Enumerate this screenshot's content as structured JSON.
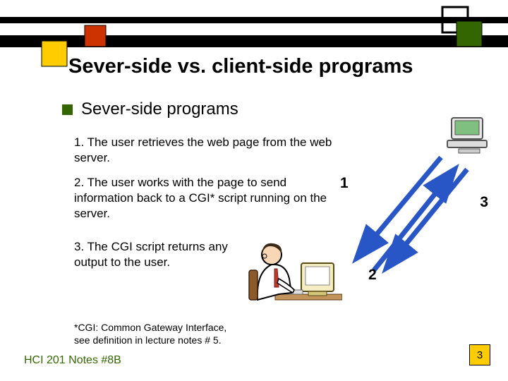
{
  "slide": {
    "title": "Sever-side vs. client-side programs",
    "subtitle": "Sever-side programs",
    "points": {
      "p1": "1. The user retrieves the web page from the web server.",
      "p2": "2. The user works with the page to send information back to a CGI* script running on the server.",
      "p3": "3. The CGI script returns any output to the user."
    },
    "footnote": "*CGI: Common Gateway Interface, see definition in lecture notes # 5.",
    "footer_left": "HCI 201 Notes #8B",
    "page_number": "3"
  },
  "diagram": {
    "labels": {
      "arrow1": "1",
      "arrow2": "2",
      "arrow3": "3"
    },
    "icons": {
      "server": "server-computer-icon",
      "user": "user-at-computer-icon"
    }
  },
  "colors": {
    "accent_green": "#336600",
    "accent_yellow": "#ffcc00",
    "accent_red": "#cc3300",
    "arrow_blue": "#2956c6"
  }
}
